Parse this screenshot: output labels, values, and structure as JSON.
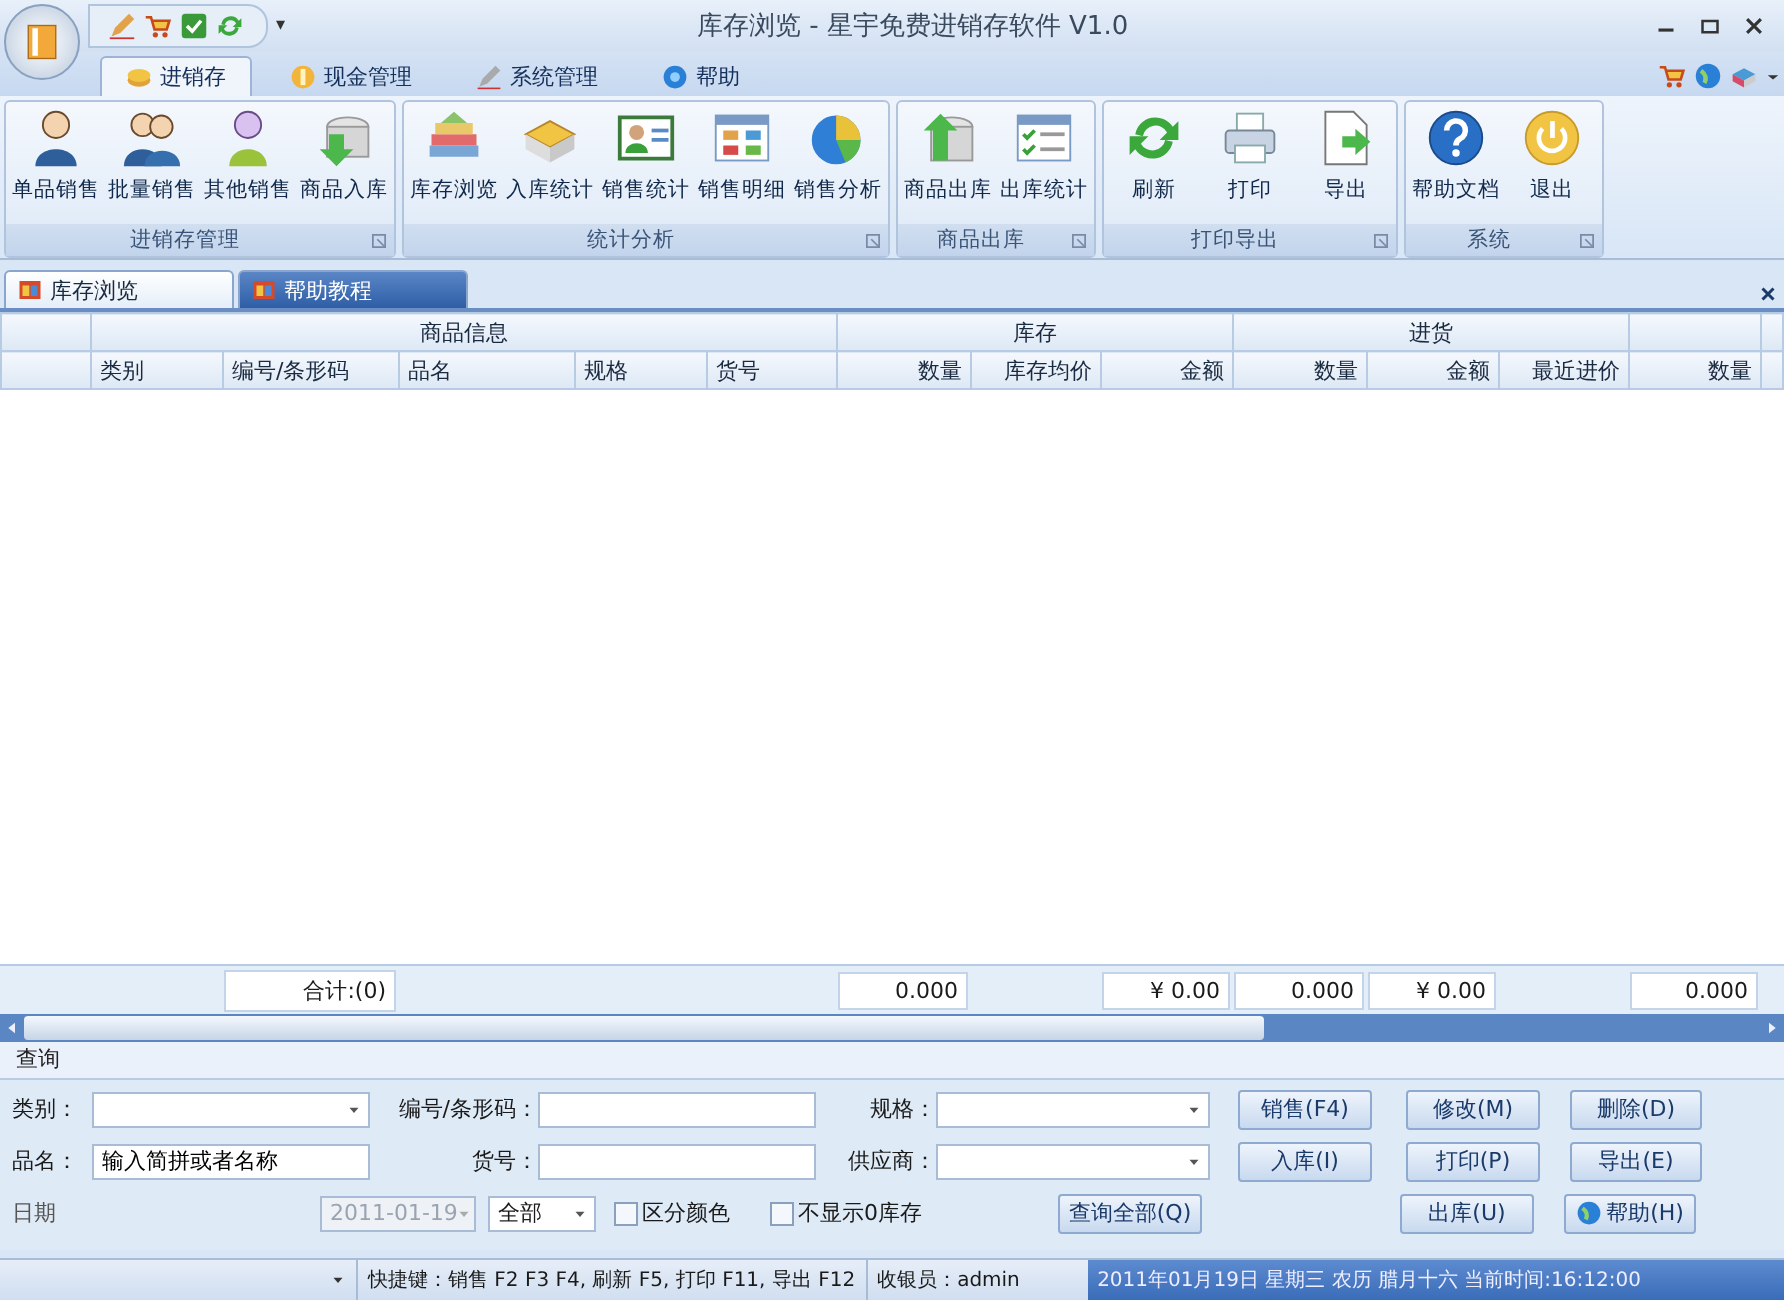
{
  "window": {
    "title": "库存浏览 - 星宇免费进销存软件 V1.0",
    "quick_access_more": "▾"
  },
  "ribbon_tabs": [
    {
      "label": "进销存",
      "selected": true
    },
    {
      "label": "现金管理",
      "selected": false
    },
    {
      "label": "系统管理",
      "selected": false
    },
    {
      "label": "帮助",
      "selected": false
    }
  ],
  "ribbon_groups": [
    {
      "label": "进销存管理",
      "buttons": [
        "单品销售",
        "批量销售",
        "其他销售",
        "商品入库"
      ]
    },
    {
      "label": "统计分析",
      "buttons": [
        "库存浏览",
        "入库统计",
        "销售统计",
        "销售明细",
        "销售分析"
      ]
    },
    {
      "label": "商品出库",
      "buttons": [
        "商品出库",
        "出库统计"
      ]
    },
    {
      "label": "打印导出",
      "buttons": [
        "刷新",
        "打印",
        "导出"
      ]
    },
    {
      "label": "系统",
      "buttons": [
        "帮助文档",
        "退出"
      ]
    }
  ],
  "document_tabs": [
    {
      "label": "库存浏览",
      "selected": true
    },
    {
      "label": "帮助教程",
      "selected": false
    }
  ],
  "table": {
    "column_groups": [
      {
        "label": "商品信息",
        "columns": [
          {
            "label": "类别"
          },
          {
            "label": "编号/条形码",
            "total": "合计:(0)"
          },
          {
            "label": "品名"
          },
          {
            "label": "规格"
          },
          {
            "label": "货号"
          }
        ]
      },
      {
        "label": "库存",
        "columns": [
          {
            "label": "数量",
            "total": "0.000"
          },
          {
            "label": "库存均价"
          },
          {
            "label": "金额",
            "total": "¥ 0.00"
          }
        ]
      },
      {
        "label": "进货",
        "columns": [
          {
            "label": "数量",
            "total": "0.000"
          },
          {
            "label": "金额",
            "total": "¥ 0.00"
          },
          {
            "label": "最近进价"
          }
        ]
      },
      {
        "columns": [
          {
            "label": "数量",
            "total": "0.000"
          }
        ]
      }
    ]
  },
  "query": {
    "title": "查询",
    "rows": [
      [
        {
          "kind": "label",
          "text": "类别："
        },
        {
          "kind": "combo"
        },
        {
          "kind": "label",
          "text": "编号/条形码："
        },
        {
          "kind": "field"
        },
        {
          "kind": "label",
          "text": "规格："
        },
        {
          "kind": "combo"
        },
        {
          "kind": "button",
          "text": "销售(F4)"
        },
        {
          "kind": "button",
          "text": "修改(M)"
        },
        {
          "kind": "button",
          "text": "删除(D)"
        }
      ],
      [
        {
          "kind": "label",
          "text": "品名："
        },
        {
          "kind": "field",
          "value": "输入简拼或者名称"
        },
        {
          "kind": "label",
          "text": "货号："
        },
        {
          "kind": "field"
        },
        {
          "kind": "label",
          "text": "供应商："
        },
        {
          "kind": "combo"
        },
        {
          "kind": "button",
          "text": "入库(I)"
        },
        {
          "kind": "button",
          "text": "打印(P)"
        },
        {
          "kind": "button",
          "text": "导出(E)"
        }
      ],
      [
        {
          "kind": "label",
          "text": "日期"
        },
        {
          "kind": "combo",
          "value": "2011-01-19",
          "disabled": true
        },
        {
          "kind": "combo",
          "value": "全部"
        },
        {
          "kind": "checkbox",
          "text": "区分颜色",
          "checked": false
        },
        {
          "kind": "checkbox",
          "text": "不显示0库存",
          "checked": false
        },
        {
          "kind": "button",
          "text": "查询全部(Q)"
        },
        {
          "kind": "empty"
        },
        {
          "kind": "button",
          "text": "出库(U)"
        },
        {
          "kind": "help_button",
          "text": "帮助(H)"
        }
      ]
    ]
  },
  "status_bar": {
    "shortcuts": "快捷键：销售 F2  F3 F4, 刷新 F5, 打印 F11, 导出 F12",
    "cashier": "收银员：admin",
    "datetime": "2011年01月19日 星期三 农历 腊月十六 当前时间:16:12:00"
  }
}
